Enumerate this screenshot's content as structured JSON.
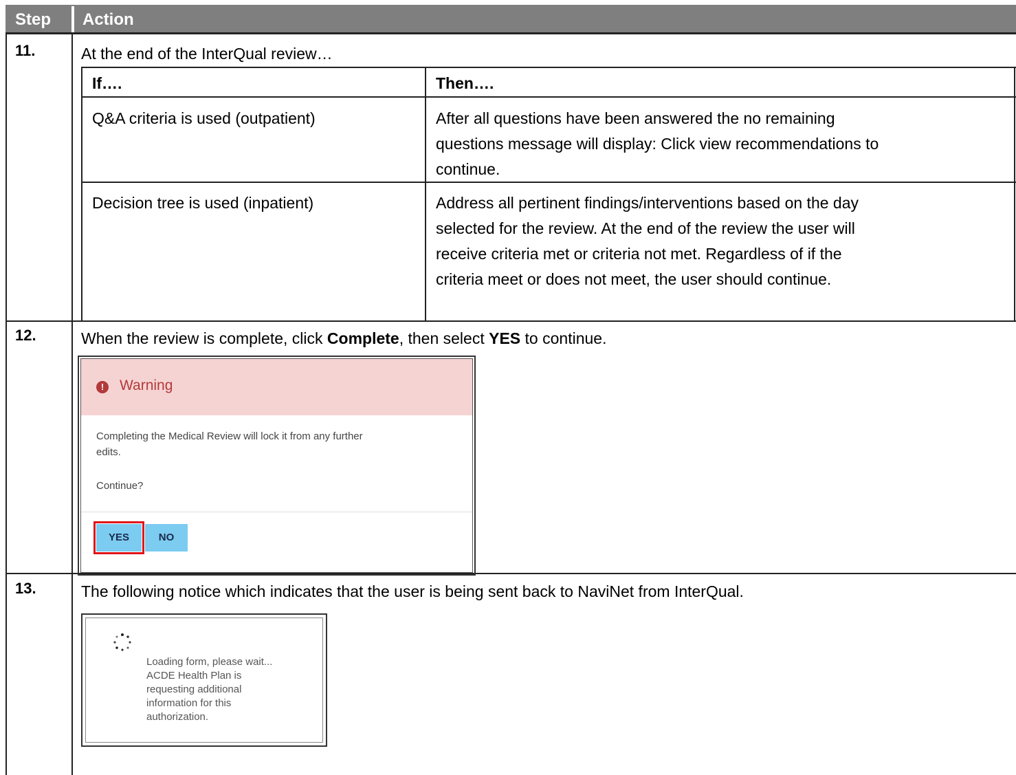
{
  "header": {
    "step": "Step",
    "action": "Action"
  },
  "rows": [
    {
      "step": "11.",
      "intro": "At the end of the InterQual review…",
      "table": {
        "col_if": "If….",
        "col_then": "Then….",
        "r1_if": "Q&A criteria is used (outpatient)",
        "r1_then": [
          "After all questions have been answered the no remaining",
          "questions message will display: Click view recommendations to",
          "continue."
        ],
        "r2_if": "Decision tree is used (inpatient)",
        "r2_then": [
          "Address all pertinent findings/interventions based on the day",
          "selected for the review. At the end of the review the user will",
          "receive criteria met or criteria not met. Regardless of if the",
          "criteria meet or does not meet, the user should continue."
        ]
      }
    },
    {
      "step": "12.",
      "text_a": "When the review is complete, click ",
      "text_b": "Complete",
      "text_c": ", then select ",
      "text_d": "YES",
      "text_e": " to continue.",
      "dialog": {
        "title": "Warning",
        "body_1": "Completing the Medical Review will lock it from any further",
        "body_2": "edits.",
        "body_3": "Continue?",
        "yes": "YES",
        "no": "NO"
      }
    },
    {
      "step": "13.",
      "text": "The following notice which indicates that the user is being sent back to NaviNet from InterQual.",
      "loading": {
        "l1": "Loading form, please wait...",
        "l2": "ACDE Health Plan is",
        "l3": "requesting additional",
        "l4": "information for this",
        "l5": "authorization."
      }
    }
  ],
  "colors": {
    "header_bg": "#7f7f7f",
    "warning_bg": "#f6d3d3",
    "warning_text": "#b23a3a",
    "button_bg": "#7ccbf0",
    "highlight": "#e0151a"
  }
}
